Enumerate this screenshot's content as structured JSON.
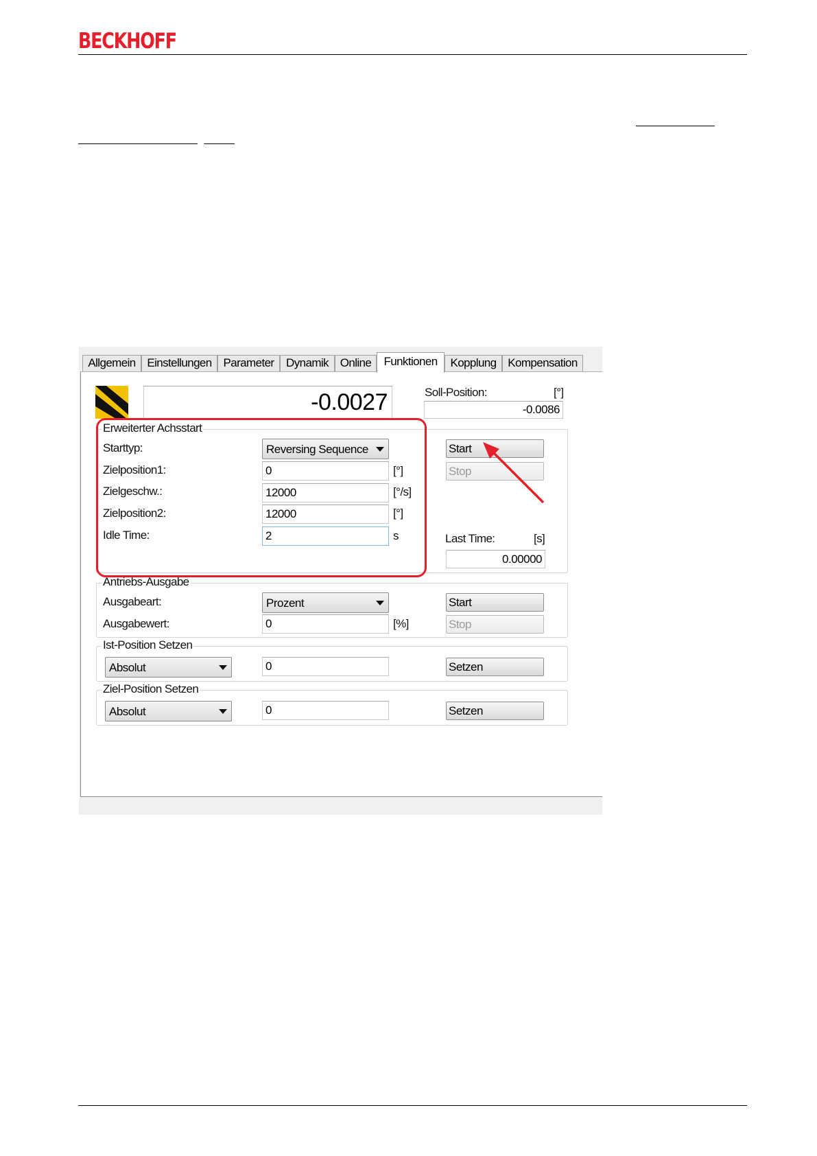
{
  "header": {
    "brand": "BECKHOFF"
  },
  "dialog": {
    "tabs": [
      {
        "label": "Allgemein"
      },
      {
        "label": "Einstellungen"
      },
      {
        "label": "Parameter"
      },
      {
        "label": "Dynamik"
      },
      {
        "label": "Online"
      },
      {
        "label": "Funktionen"
      },
      {
        "label": "Kopplung"
      },
      {
        "label": "Kompensation"
      }
    ],
    "active_tab": "Funktionen",
    "position_display": "-0.0027",
    "soll_position": {
      "label": "Soll-Position:",
      "unit": "[°]",
      "value": "-0.0086"
    },
    "erweiterter_achsstart": {
      "title": "Erweiterter Achsstart",
      "starttyp_label": "Starttyp:",
      "starttyp_value": "Reversing Sequence",
      "zielposition1_label": "Zielposition1:",
      "zielposition1_value": "0",
      "zielposition1_unit": "[°]",
      "zielgeschw_label": "Zielgeschw.:",
      "zielgeschw_value": "12000",
      "zielgeschw_unit": "[°/s]",
      "zielposition2_label": "Zielposition2:",
      "zielposition2_value": "12000",
      "zielposition2_unit": "[°]",
      "idle_time_label": "Idle Time:",
      "idle_time_value": "2",
      "idle_time_unit": "s",
      "start_label": "Start",
      "stop_label": "Stop",
      "last_time_label": "Last Time:",
      "last_time_unit": "[s]",
      "last_time_value": "0.00000"
    },
    "antriebs_ausgabe": {
      "title": "Antriebs-Ausgabe",
      "ausgabeart_label": "Ausgabeart:",
      "ausgabeart_value": "Prozent",
      "ausgabewert_label": "Ausgabewert:",
      "ausgabewert_value": "0",
      "ausgabewert_unit": "[%]",
      "start_label": "Start",
      "stop_label": "Stop"
    },
    "ist_position_setzen": {
      "title": "Ist-Position Setzen",
      "mode_value": "Absolut",
      "value": "0",
      "button_label": "Setzen"
    },
    "ziel_position_setzen": {
      "title": "Ziel-Position Setzen",
      "mode_value": "Absolut",
      "value": "0",
      "button_label": "Setzen"
    },
    "highlight_color": "#e3202b"
  }
}
